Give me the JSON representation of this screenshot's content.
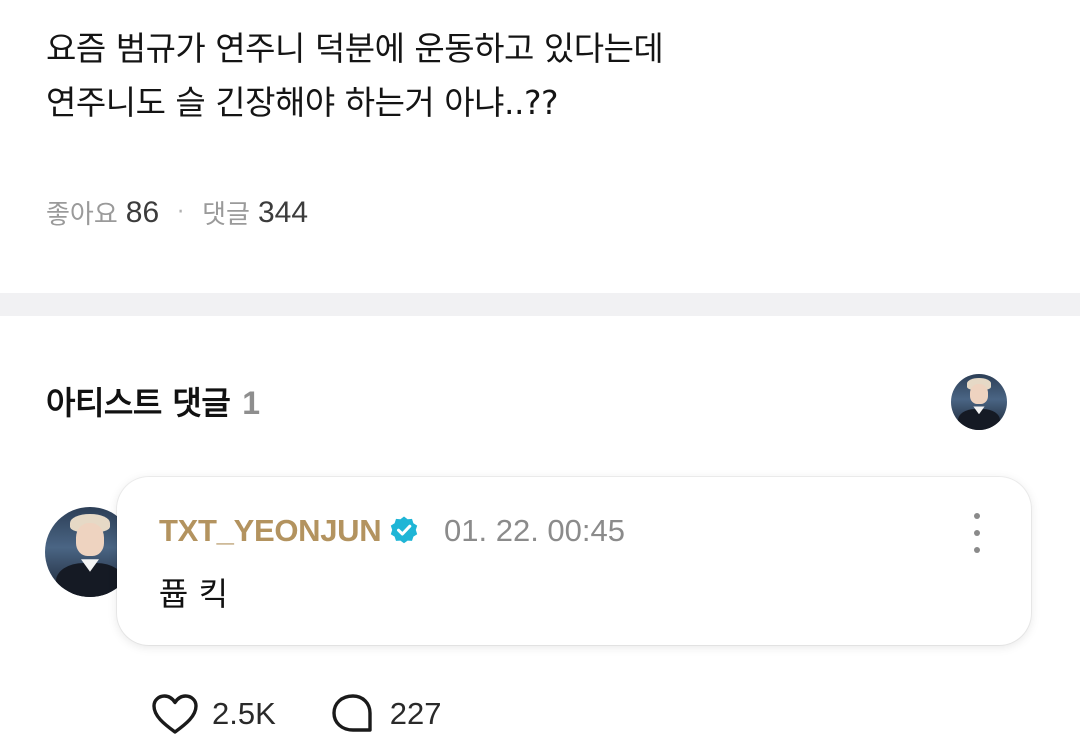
{
  "post": {
    "lines": [
      "요즘 범규가 연주니 덕분에 운동하고 있다는데",
      "연주니도 슬 긴장해야 하는거 아냐..??"
    ],
    "likes_label": "좋아요",
    "likes_count": "86",
    "separator": "·",
    "comments_label": "댓글",
    "comments_count": "344"
  },
  "artist_comments": {
    "title": "아티스트 댓글",
    "count": "1"
  },
  "comment": {
    "author": "TXT_YEONJUN",
    "timestamp": "01. 22. 00:45",
    "text": "퓹 킥",
    "verified_color": "#1fb5d6"
  },
  "actions": {
    "like_count": "2.5K",
    "reply_count": "227"
  },
  "icons": [
    "verified-icon",
    "more-icon",
    "heart-icon",
    "comment-bubble-icon"
  ]
}
